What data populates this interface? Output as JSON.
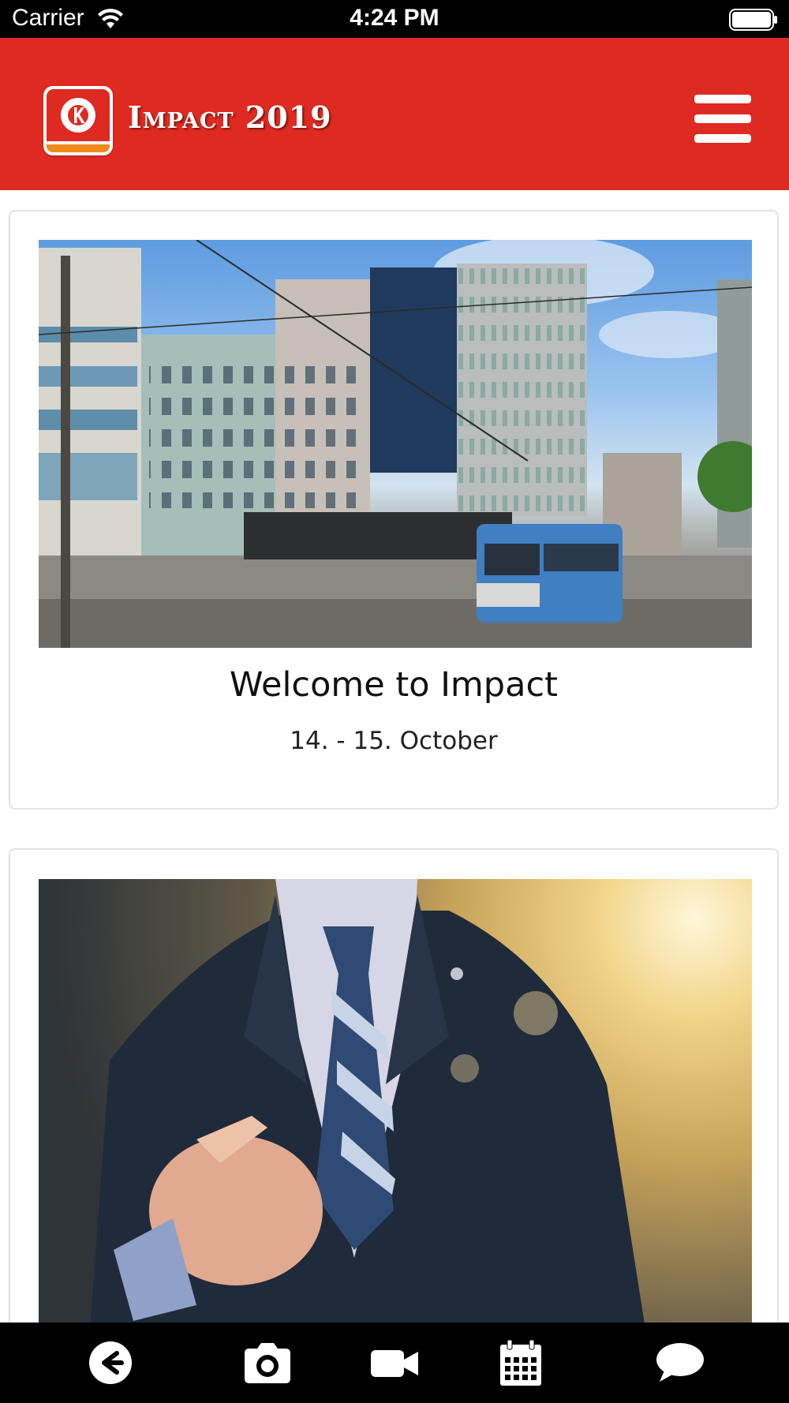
{
  "status_bar": {
    "carrier": "Carrier",
    "time": "4:24 PM",
    "wifi_icon": "wifi-icon",
    "battery_icon": "battery-icon"
  },
  "header": {
    "logo_icon": "circle-k-logo",
    "title": "Impact 2019",
    "menu_icon": "hamburger-menu-icon",
    "brand_color": "#de2a20"
  },
  "cards": [
    {
      "image_icon": "building-photo",
      "title": "Welcome to Impact",
      "subtitle": "14. - 15. October"
    },
    {
      "image_icon": "businessman-pointing-photo"
    }
  ],
  "tab_bar": {
    "items": [
      {
        "icon": "back-arrow-icon"
      },
      {
        "icon": "camera-icon"
      },
      {
        "icon": "video-camera-icon"
      },
      {
        "icon": "calendar-icon"
      },
      {
        "icon": "chat-bubble-icon"
      }
    ]
  }
}
